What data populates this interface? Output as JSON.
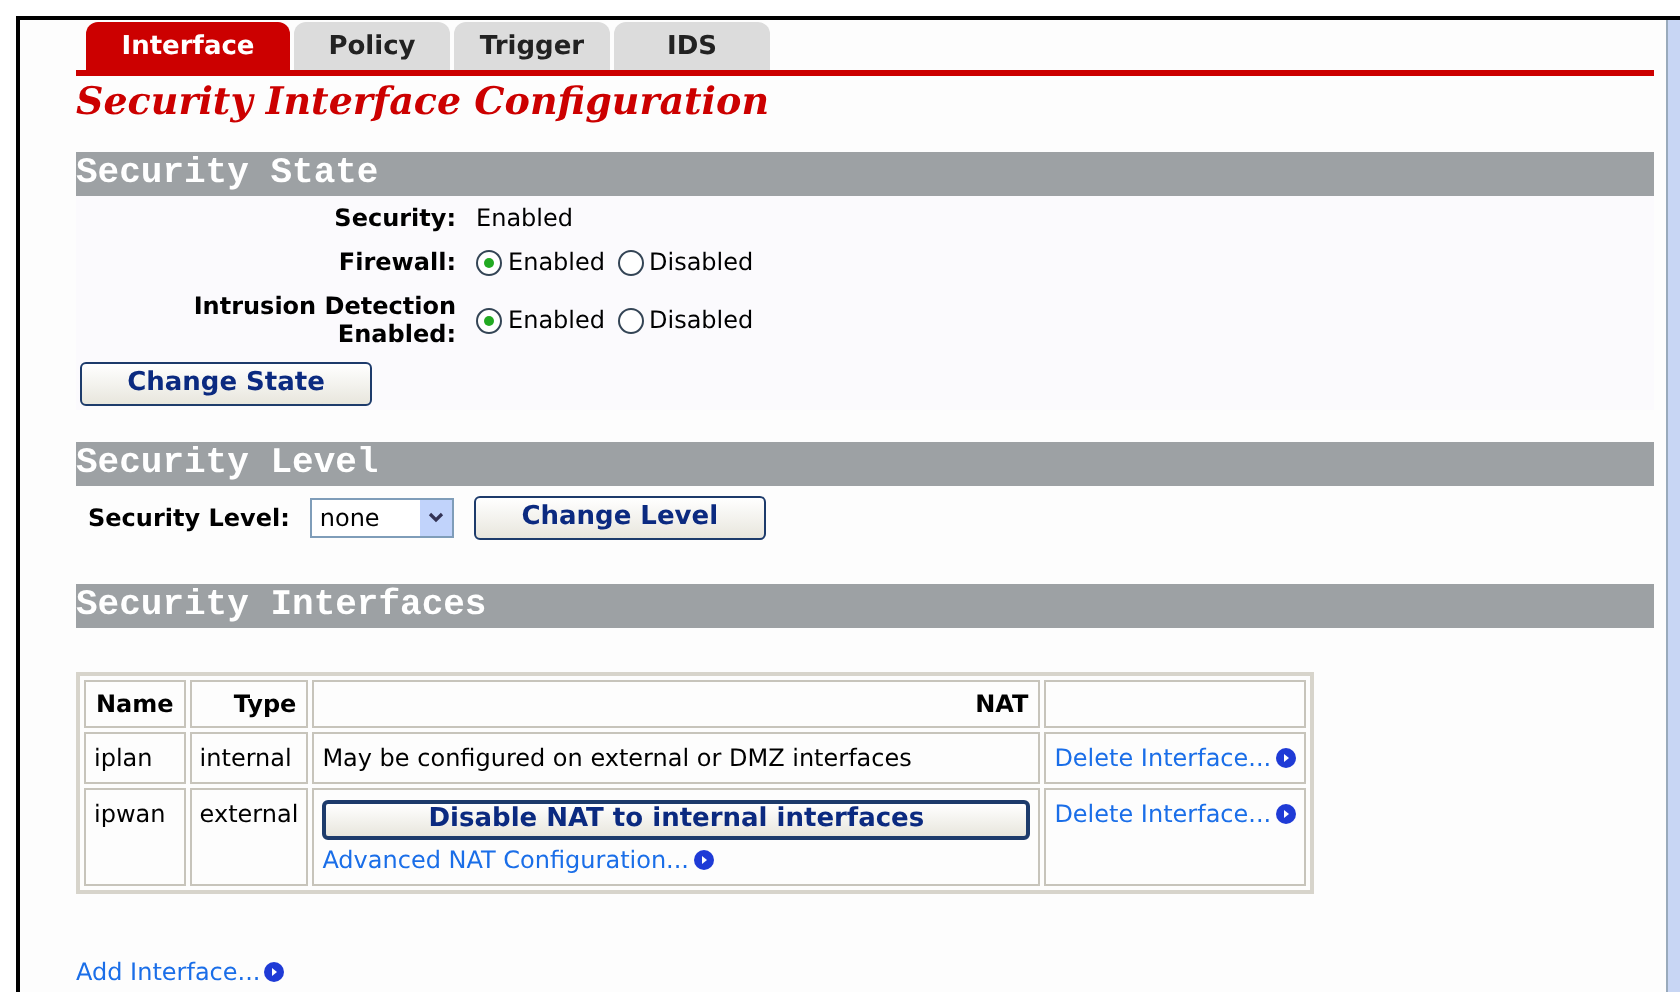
{
  "tabs": [
    {
      "label": "Interface",
      "selected": true
    },
    {
      "label": "Policy",
      "selected": false
    },
    {
      "label": "Trigger",
      "selected": false
    },
    {
      "label": "IDS",
      "selected": false
    }
  ],
  "title": "Security Interface Configuration",
  "state_section": {
    "heading": "Security State",
    "security_label": "Security:",
    "security_value": "Enabled",
    "radio_rows": [
      {
        "label": "Firewall:",
        "options": [
          {
            "label": "Enabled",
            "selected": true
          },
          {
            "label": "Disabled",
            "selected": false
          }
        ]
      },
      {
        "label": "Intrusion Detection Enabled:",
        "options": [
          {
            "label": "Enabled",
            "selected": true
          },
          {
            "label": "Disabled",
            "selected": false
          }
        ]
      }
    ],
    "button": "Change State"
  },
  "level_section": {
    "heading": "Security Level",
    "label": "Security Level:",
    "select_value": "none",
    "button": "Change Level"
  },
  "interfaces_section": {
    "heading": "Security Interfaces",
    "columns": [
      "Name",
      "Type",
      "NAT"
    ],
    "rows": [
      {
        "name": "iplan",
        "type": "internal",
        "nat_text": "May be configured on external or DMZ interfaces",
        "action": "Delete Interface..."
      },
      {
        "name": "ipwan",
        "type": "external",
        "nat_button": "Disable NAT to internal interfaces",
        "nat_link": "Advanced NAT Configuration...",
        "action": "Delete Interface..."
      }
    ],
    "add_link": "Add Interface..."
  }
}
